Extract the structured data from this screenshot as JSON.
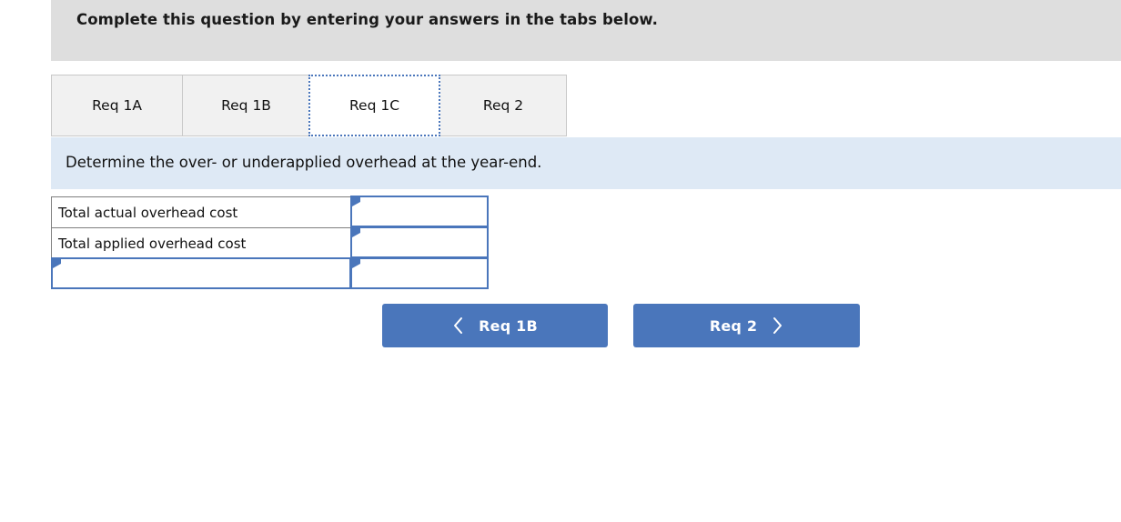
{
  "banner": {
    "text": "Complete this question by entering your answers in the tabs below."
  },
  "tabs": [
    {
      "label": "Req 1A",
      "active": false
    },
    {
      "label": "Req 1B",
      "active": false
    },
    {
      "label": "Req 1C",
      "active": true
    },
    {
      "label": "Req 2",
      "active": false
    }
  ],
  "sub_instruction": {
    "text": "Determine the over- or underapplied overhead at the year-end."
  },
  "answer_table": {
    "rows": [
      {
        "label": "Total actual overhead cost",
        "label_is_input": false,
        "value": "",
        "value_placeholder": ""
      },
      {
        "label": "Total applied overhead cost",
        "label_is_input": false,
        "value": "",
        "value_placeholder": ""
      },
      {
        "label": "",
        "label_is_input": true,
        "value": "",
        "value_placeholder": ""
      }
    ]
  },
  "navigation": {
    "prev_label": "Req 1B",
    "next_label": "Req 2",
    "prev_icon": "chevron-left-icon",
    "next_icon": "chevron-right-icon"
  },
  "colors": {
    "banner_bg": "#dedede",
    "subbar_bg": "#dee9f5",
    "tab_bg": "#f1f1f1",
    "accent_blue": "#4a76bb",
    "border_gray": "#7f7f7f"
  }
}
